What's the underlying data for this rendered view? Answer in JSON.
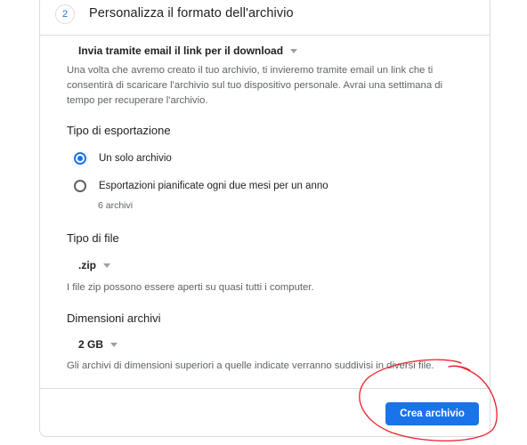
{
  "step": {
    "number": "2",
    "title": "Personalizza il formato dell'archivio"
  },
  "delivery": {
    "method": "Invia tramite email il link per il download",
    "description": "Una volta che avremo creato il tuo archivio, ti invieremo tramite email un link che ti consentirà di scaricare l'archivio sul tuo dispositivo personale. Avrai una settimana di tempo per recuperare l'archivio."
  },
  "export_type": {
    "title": "Tipo di esportazione",
    "options": [
      {
        "label": "Un solo archivio",
        "checked": true
      },
      {
        "label": "Esportazioni pianificate ogni due mesi per un anno",
        "checked": false,
        "sub": "6 archivi"
      }
    ]
  },
  "file_type": {
    "title": "Tipo di file",
    "value": ".zip",
    "description": "I file zip possono essere aperti su quasi tutti i computer."
  },
  "archive_size": {
    "title": "Dimensioni archivi",
    "value": "2 GB",
    "description": "Gli archivi di dimensioni superiori a quelle indicate verranno suddivisi in diversi file."
  },
  "actions": {
    "create_label": "Crea archivio"
  },
  "colors": {
    "primary": "#1a73e8",
    "annotation": "#e8202a"
  },
  "icons": {
    "radio_checked": "radio-checked-icon",
    "radio_unchecked": "radio-unchecked-icon",
    "dropdown": "dropdown-caret-icon"
  }
}
